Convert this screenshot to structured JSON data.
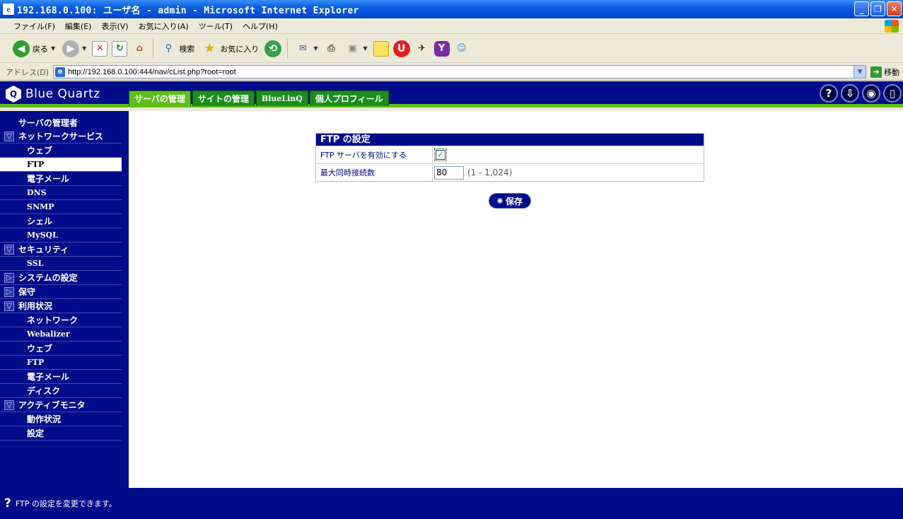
{
  "window": {
    "title": "192.168.0.100: ユーザ名 - admin - Microsoft Internet Explorer"
  },
  "menu": [
    "ファイル(F)",
    "編集(E)",
    "表示(V)",
    "お気に入り(A)",
    "ツール(T)",
    "ヘルプ(H)"
  ],
  "toolbar": {
    "back_label": "戻る",
    "search_label": "検索",
    "favorites_label": "お気に入り"
  },
  "address": {
    "label": "アドレス(D)",
    "url": "http://192.168.0.100:444/nav/cList.php?root=root",
    "go_label": "移動"
  },
  "app": {
    "logo_text": "Blue Quartz",
    "tabs": [
      "サーバの管理",
      "サイトの管理",
      "BlueLinQ",
      "個人プロフィール"
    ]
  },
  "sidebar": {
    "top": "サーバの管理者",
    "items": [
      {
        "label": "ネットワークサービス",
        "type": "cat",
        "expanded": true
      },
      {
        "label": "ウェブ",
        "type": "sub"
      },
      {
        "label": "FTP",
        "type": "sub",
        "selected": true
      },
      {
        "label": "電子メール",
        "type": "sub"
      },
      {
        "label": "DNS",
        "type": "sub"
      },
      {
        "label": "SNMP",
        "type": "sub"
      },
      {
        "label": "シェル",
        "type": "sub"
      },
      {
        "label": "MySQL",
        "type": "sub"
      },
      {
        "label": "セキュリティ",
        "type": "cat",
        "expanded": true
      },
      {
        "label": "SSL",
        "type": "sub"
      },
      {
        "label": "システムの設定",
        "type": "cat",
        "expanded": false
      },
      {
        "label": "保守",
        "type": "cat",
        "expanded": false
      },
      {
        "label": "利用状況",
        "type": "cat",
        "expanded": true
      },
      {
        "label": "ネットワーク",
        "type": "sub"
      },
      {
        "label": "Webalizer",
        "type": "sub"
      },
      {
        "label": "ウェブ",
        "type": "sub"
      },
      {
        "label": "FTP",
        "type": "sub"
      },
      {
        "label": "電子メール",
        "type": "sub"
      },
      {
        "label": "ディスク",
        "type": "sub"
      },
      {
        "label": "アクティブモニタ",
        "type": "cat",
        "expanded": true
      },
      {
        "label": "動作状況",
        "type": "sub"
      },
      {
        "label": "設定",
        "type": "sub"
      }
    ]
  },
  "panel": {
    "title": "FTP の設定",
    "enable_label": "FTP サーバを有効にする",
    "enable_checked": true,
    "max_conn_label": "最大同時接続数",
    "max_conn_value": "80",
    "max_conn_hint": "(1 - 1,024)",
    "save_label": "保存"
  },
  "status": {
    "text": "FTP の設定を変更できます。"
  }
}
